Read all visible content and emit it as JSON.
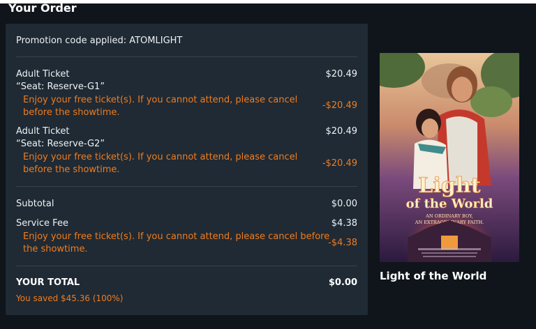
{
  "page": {
    "title": "Your Order"
  },
  "order": {
    "promotion": "Promotion code applied: ATOMLIGHT",
    "free_notice": "Enjoy your free ticket(s). If you cannot attend, please cancel before the showtime.",
    "tickets": [
      {
        "label": "Adult Ticket",
        "seat": "“Seat: Reserve-G1”",
        "price": "$20.49",
        "discount": "-$20.49"
      },
      {
        "label": "Adult Ticket",
        "seat": "“Seat: Reserve-G2”",
        "price": "$20.49",
        "discount": "-$20.49"
      }
    ],
    "subtotal": {
      "label": "Subtotal",
      "value": "$0.00"
    },
    "service_fee": {
      "label": "Service Fee",
      "value": "$4.38",
      "discount": "-$4.38"
    },
    "total": {
      "label": "YOUR TOTAL",
      "value": "$0.00"
    },
    "saved": "You saved $45.36 (100%)"
  },
  "movie": {
    "title": "Light of the World",
    "poster_title_line1": "Light",
    "poster_title_line2": "of the World",
    "poster_tagline_1": "AN ORDINARY BOY,",
    "poster_tagline_2": "AN EXTRAORDINARY FAITH."
  },
  "colors": {
    "accent": "#f07c1f",
    "panel": "#1f2a34",
    "background": "#0f151b"
  }
}
